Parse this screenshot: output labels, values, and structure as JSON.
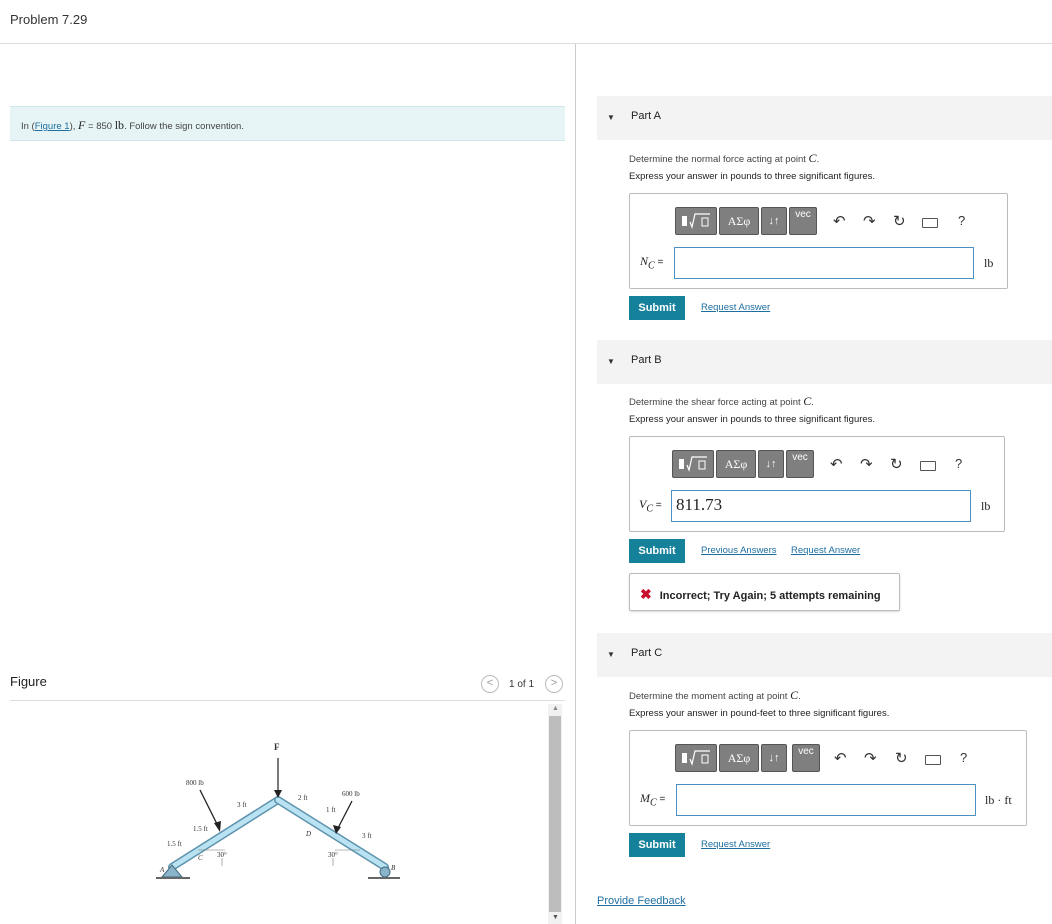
{
  "problem": {
    "title": "Problem 7.29",
    "prefix": "In (",
    "figure_link": "Figure 1",
    "mid": "), ",
    "var": "F",
    "eq": " = 850 ",
    "unit": "lb",
    "suffix": ". Follow the sign convention."
  },
  "figure_panel": {
    "label": "Figure",
    "prev": "<",
    "next": ">",
    "pager": "1 of 1"
  },
  "diagram": {
    "labels": {
      "F": "F",
      "w800": "800 lb",
      "w600": "600 lb",
      "d3": "3 ft",
      "d2": "2 ft",
      "d1": "1 ft",
      "d15a": "1.5 ft",
      "d15b": "1.5 ft",
      "d3b": "3 ft",
      "angL": "30°",
      "angR": "30°",
      "A": "A",
      "B": "B",
      "C": "C",
      "D": "D"
    }
  },
  "toolbar": {
    "ase": "ΑΣφ",
    "arrows": "↓↑",
    "vec": "vec",
    "undo": "↶",
    "redo": "↷",
    "reset": "↻",
    "help": "?"
  },
  "parts": [
    {
      "name": "Part A",
      "question_pre": "Determine the normal force acting at point ",
      "point": "C",
      "question_post": ".",
      "express": "Express your answer in pounds to three significant figures.",
      "label_var": "N",
      "label_sub": "C",
      "label_eq": " =",
      "value": "",
      "unit": "lb",
      "submit": "Submit",
      "links": [
        "Request Answer"
      ]
    },
    {
      "name": "Part B",
      "question_pre": "Determine the shear force acting at point ",
      "point": "C",
      "question_post": ".",
      "express": "Express your answer in pounds to three significant figures.",
      "label_var": "V",
      "label_sub": "C",
      "label_eq": " =",
      "value": "811.73",
      "unit": "lb",
      "submit": "Submit",
      "links": [
        "Previous Answers",
        "Request Answer"
      ],
      "feedback": "Incorrect; Try Again; 5 attempts remaining"
    },
    {
      "name": "Part C",
      "question_pre": "Determine the moment acting at point ",
      "point": "C",
      "question_post": ".",
      "express": "Express your answer in pound-feet to three significant figures.",
      "label_var": "M",
      "label_sub": "C",
      "label_eq": " =",
      "value": "",
      "unit": "lb · ft",
      "submit": "Submit",
      "links": [
        "Request Answer"
      ]
    }
  ],
  "footer": {
    "feedback_link": "Provide Feedback"
  },
  "colors": {
    "accent": "#15819a",
    "link": "#1e6ea0",
    "info_bg": "#e6f4f6",
    "error": "#c8102e",
    "beam": "#9fd3ea"
  }
}
